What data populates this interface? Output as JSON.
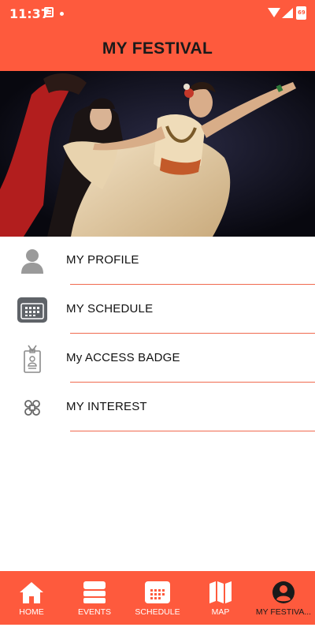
{
  "status_bar": {
    "time": "11:37",
    "battery": "69"
  },
  "header": {
    "title": "MY FESTIVAL"
  },
  "menu": {
    "items": [
      {
        "label": "MY PROFILE",
        "icon": "person-icon"
      },
      {
        "label": "MY SCHEDULE",
        "icon": "calendar-icon"
      },
      {
        "label": "My ACCESS BADGE",
        "icon": "badge-icon"
      },
      {
        "label": "MY INTEREST",
        "icon": "interest-icon"
      }
    ]
  },
  "bottom_nav": {
    "items": [
      {
        "label": "HOME",
        "icon": "home-icon"
      },
      {
        "label": "EVENTS",
        "icon": "events-icon"
      },
      {
        "label": "SCHEDULE",
        "icon": "calendar-icon"
      },
      {
        "label": "MAP",
        "icon": "map-icon"
      },
      {
        "label": "MY FESTIVA...",
        "icon": "account-icon"
      }
    ],
    "active_index": 4
  },
  "colors": {
    "accent": "#fe5a3d",
    "divider": "#f06a4f",
    "icon_gray": "#9a9a9a"
  }
}
